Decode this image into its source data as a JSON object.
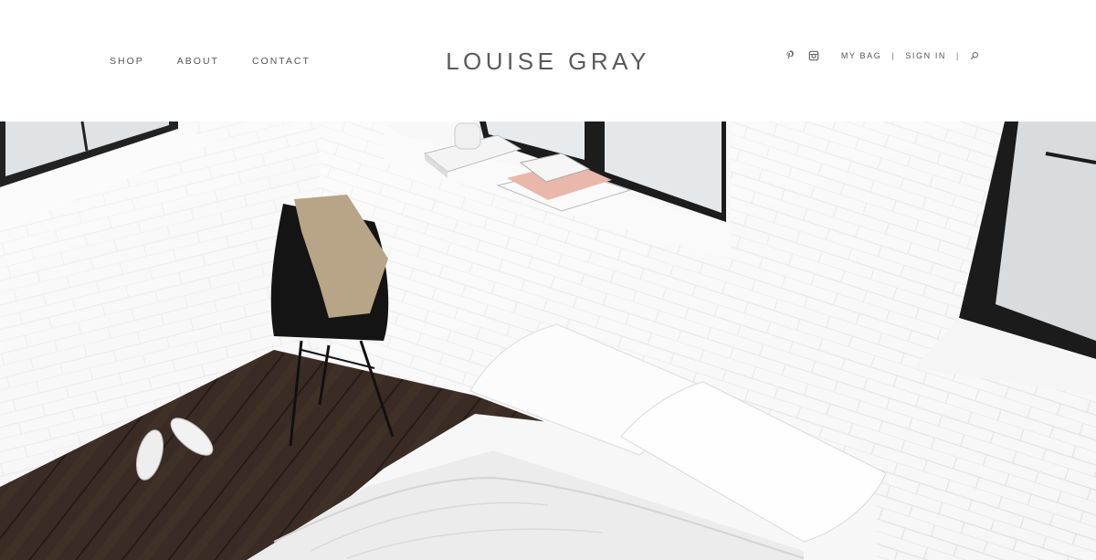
{
  "nav": {
    "items": [
      {
        "label": "SHOP"
      },
      {
        "label": "ABOUT"
      },
      {
        "label": "CONTACT"
      }
    ]
  },
  "brand": {
    "name": "LOUISE GRAY"
  },
  "social": {
    "icons": [
      "pinterest-icon",
      "instagram-icon"
    ]
  },
  "utility": {
    "bag_label": "MY BAG",
    "separator": "|",
    "signin_label": "SIGN IN",
    "search_icon": "search-icon"
  },
  "hero": {
    "image": "minimal white brick bedroom with black chair, sneakers and bed"
  },
  "colors": {
    "text": "#555555",
    "logo": "#5a5a5a",
    "background": "#ffffff"
  }
}
